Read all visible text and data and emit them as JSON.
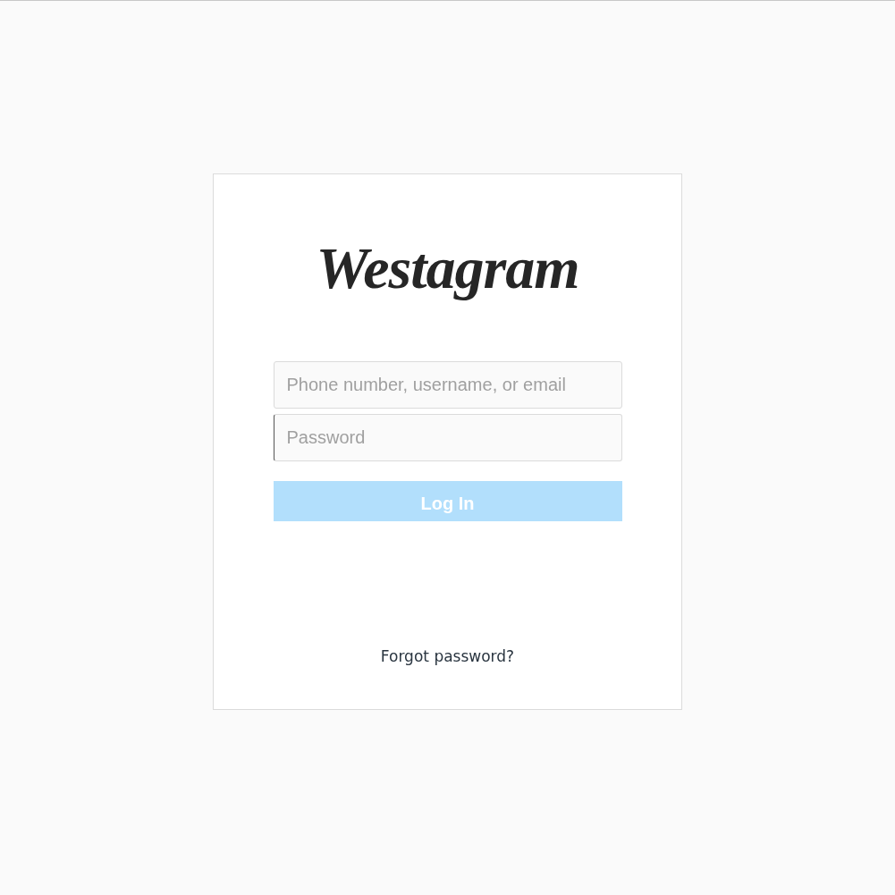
{
  "logo": {
    "text": "Westagram"
  },
  "fields": [
    {
      "placeholder": "Phone number, username, or email",
      "kind": "text"
    },
    {
      "placeholder": "Password",
      "kind": "password"
    }
  ],
  "login_button": {
    "label": "Log In",
    "disabled": true
  },
  "forgot_link": {
    "label": "Forgot password?"
  }
}
